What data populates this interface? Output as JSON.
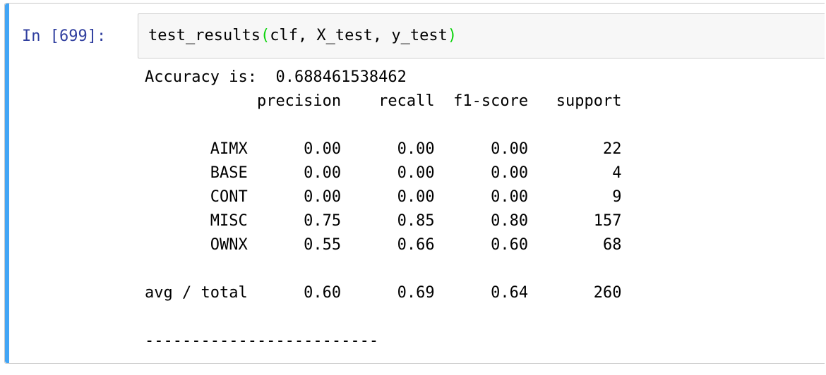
{
  "cell": {
    "prompt": "In [699]:",
    "code": {
      "func": "test_results",
      "open_paren": "(",
      "args": "clf, X_test, y_test",
      "close_paren": ")"
    }
  },
  "output": {
    "accuracy_label": "Accuracy is:",
    "accuracy_value": "0.688461538462",
    "headers": [
      "precision",
      "recall",
      "f1-score",
      "support"
    ],
    "rows": [
      {
        "label": "AIMX",
        "precision": "0.00",
        "recall": "0.00",
        "f1": "0.00",
        "support": "22"
      },
      {
        "label": "BASE",
        "precision": "0.00",
        "recall": "0.00",
        "f1": "0.00",
        "support": "4"
      },
      {
        "label": "CONT",
        "precision": "0.00",
        "recall": "0.00",
        "f1": "0.00",
        "support": "9"
      },
      {
        "label": "MISC",
        "precision": "0.75",
        "recall": "0.85",
        "f1": "0.80",
        "support": "157"
      },
      {
        "label": "OWNX",
        "precision": "0.55",
        "recall": "0.66",
        "f1": "0.60",
        "support": "68"
      }
    ],
    "total": {
      "label": "avg / total",
      "precision": "0.60",
      "recall": "0.69",
      "f1": "0.64",
      "support": "260"
    },
    "separator": "-------------------------"
  },
  "colors": {
    "selection_bar": "#42a5f5",
    "prompt": "#303f9f",
    "paren_match": "#0bd40b",
    "input_bg": "#f7f7f7"
  }
}
